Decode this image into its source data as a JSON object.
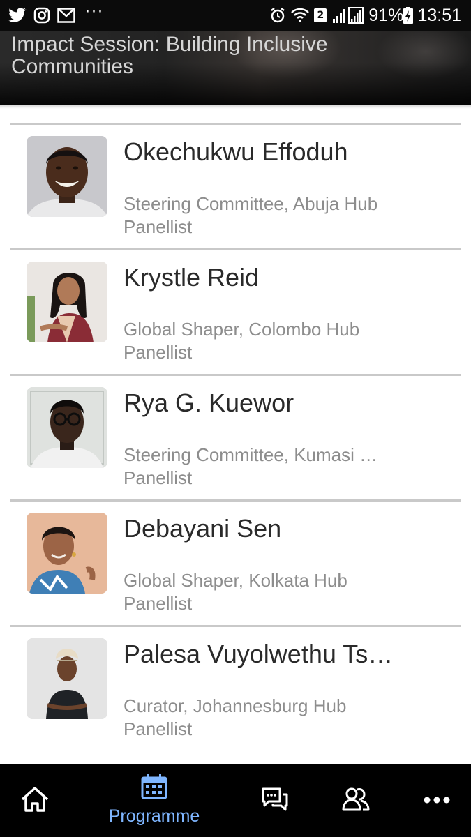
{
  "status_bar": {
    "battery": "91%",
    "time": "13:51",
    "sim_badge": "2",
    "overflow": "···",
    "icons": [
      "twitter-icon",
      "instagram-icon",
      "gmail-icon",
      "alarm-icon",
      "wifi-icon",
      "signal-icon",
      "battery-icon"
    ]
  },
  "header": {
    "title": "Impact Session: Building Inclusive Communities"
  },
  "speakers": [
    {
      "name": "Okechukwu Effoduh",
      "role": "Steering Committee, Abuja Hub",
      "type": "Panellist"
    },
    {
      "name": "Krystle Reid",
      "role": "Global Shaper, Colombo Hub",
      "type": "Panellist"
    },
    {
      "name": "Rya G. Kuewor",
      "role": "Steering Committee, Kumasi …",
      "type": "Panellist"
    },
    {
      "name": "Debayani Sen",
      "role": "Global Shaper, Kolkata Hub",
      "type": "Panellist"
    },
    {
      "name": "Palesa Vuyolwethu Ts…",
      "role": "Curator, Johannesburg Hub",
      "type": "Panellist"
    }
  ],
  "bottom_nav": {
    "programme_label": "Programme",
    "active": "programme",
    "active_color": "#7fb6ff",
    "items": [
      "home-icon",
      "calendar-icon",
      "chat-icon",
      "people-icon",
      "more-icon"
    ]
  }
}
